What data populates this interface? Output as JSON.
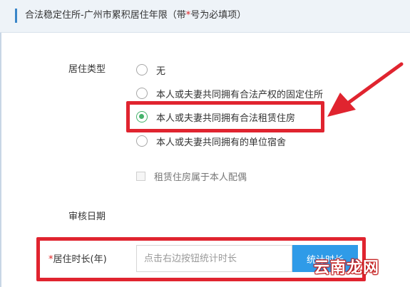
{
  "header": {
    "title_prefix": "合法稳定住所-广州市累积居住年限（带",
    "required_star": "*",
    "title_suffix": "号为必填项）"
  },
  "form": {
    "residence_type_label": "居住类型",
    "residence_options": [
      {
        "label": "无",
        "checked": false
      },
      {
        "label": "本人或夫妻共同拥有合法产权的固定住所",
        "checked": false
      },
      {
        "label": "本人或夫妻共同拥有合法租赁住房",
        "checked": true
      },
      {
        "label": "本人或夫妻共同拥有的单位宿舍",
        "checked": false
      }
    ],
    "spouse_checkbox_label": "租赁住房属于本人配偶",
    "review_date_label": "审核日期",
    "duration": {
      "required_star": "*",
      "label": "居住时长(年)",
      "placeholder": "点击右边按钮统计时长",
      "button_label": "统计时长"
    }
  },
  "watermark": "云南龙网",
  "colors": {
    "accent_blue": "#2f9be8",
    "radio_green": "#45b26b",
    "highlight_red": "#e0242f"
  }
}
